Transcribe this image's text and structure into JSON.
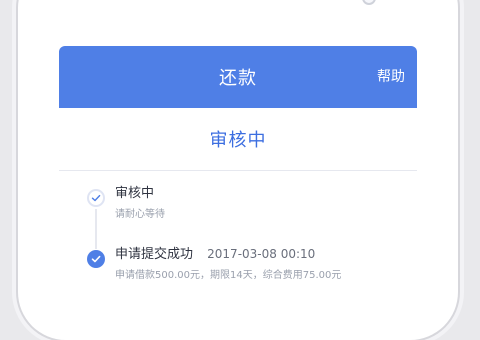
{
  "header": {
    "title": "还款",
    "help_label": "帮助"
  },
  "status": {
    "title": "审核中"
  },
  "steps": [
    {
      "title": "审核中",
      "subtitle": "请耐心等待"
    },
    {
      "title": "申请提交成功",
      "time": "2017-03-08 00:10",
      "subtitle": "申请借款500.00元，期限14天，综合费用75.00元"
    }
  ],
  "icons": {
    "check": "check-icon",
    "current": "check-filled-icon"
  },
  "colors": {
    "primary": "#4f7fe6",
    "primary_text": "#3c6ee0",
    "background": "#f3f5f9"
  }
}
